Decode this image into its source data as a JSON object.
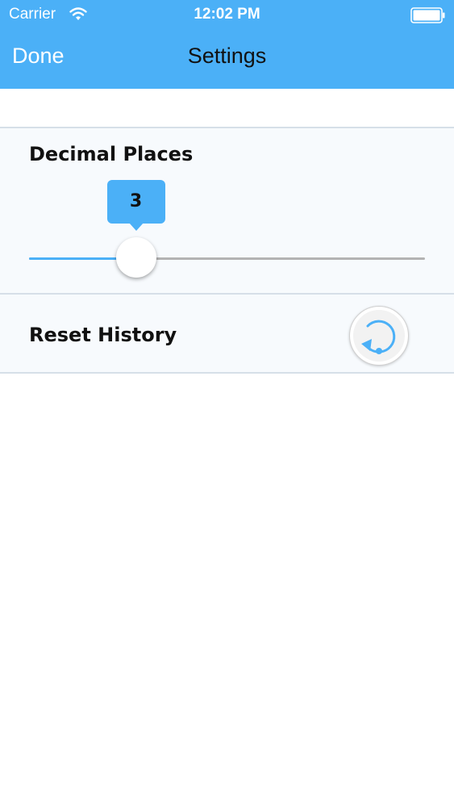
{
  "status_bar": {
    "carrier": "Carrier",
    "time": "12:02 PM",
    "icons": [
      "wifi-icon",
      "battery-icon"
    ]
  },
  "nav": {
    "done_label": "Done",
    "title": "Settings"
  },
  "decimal_places": {
    "label": "Decimal Places",
    "value": "3",
    "slider_fraction": 0.27
  },
  "reset_history": {
    "label": "Reset History",
    "icon": "reset-icon"
  },
  "colors": {
    "accent": "#4bb0f7",
    "section_background": "#f7fafd",
    "divider": "#d6dfe8"
  }
}
